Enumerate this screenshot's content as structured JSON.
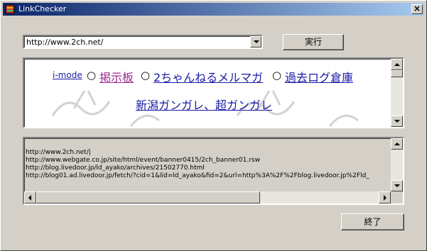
{
  "window": {
    "title": "LinkChecker",
    "close_glyph": "×"
  },
  "url_combo": {
    "value": "http://www.2ch.net/"
  },
  "buttons": {
    "run": "実行",
    "exit": "終了"
  },
  "browser": {
    "links": {
      "imode": "i-mode",
      "board": "掲示板",
      "mailmag": "2ちゃんねるメルマガ",
      "archive": "過去ログ倉庫",
      "niigata": "新潟ガンガレ、超ガンガレ"
    },
    "separator": "○",
    "colors": {
      "link": "#1a1aa6",
      "visited": "#9b2d8b"
    }
  },
  "log": {
    "lines": [
      "http://www.2ch.net/|",
      "http://www.webgate.co.jp/site/html/event/banner0415/2ch_banner01.rsw",
      "http://blog.livedoor.jp/ld_ayako/archives/21502770.html",
      "http://blog01.ad.livedoor.jp/fetch/?cid=1&lid=ld_ayako&fid=2&url=http%3A%2F%2Fblog.livedoor.jp%2Fld_"
    ]
  }
}
